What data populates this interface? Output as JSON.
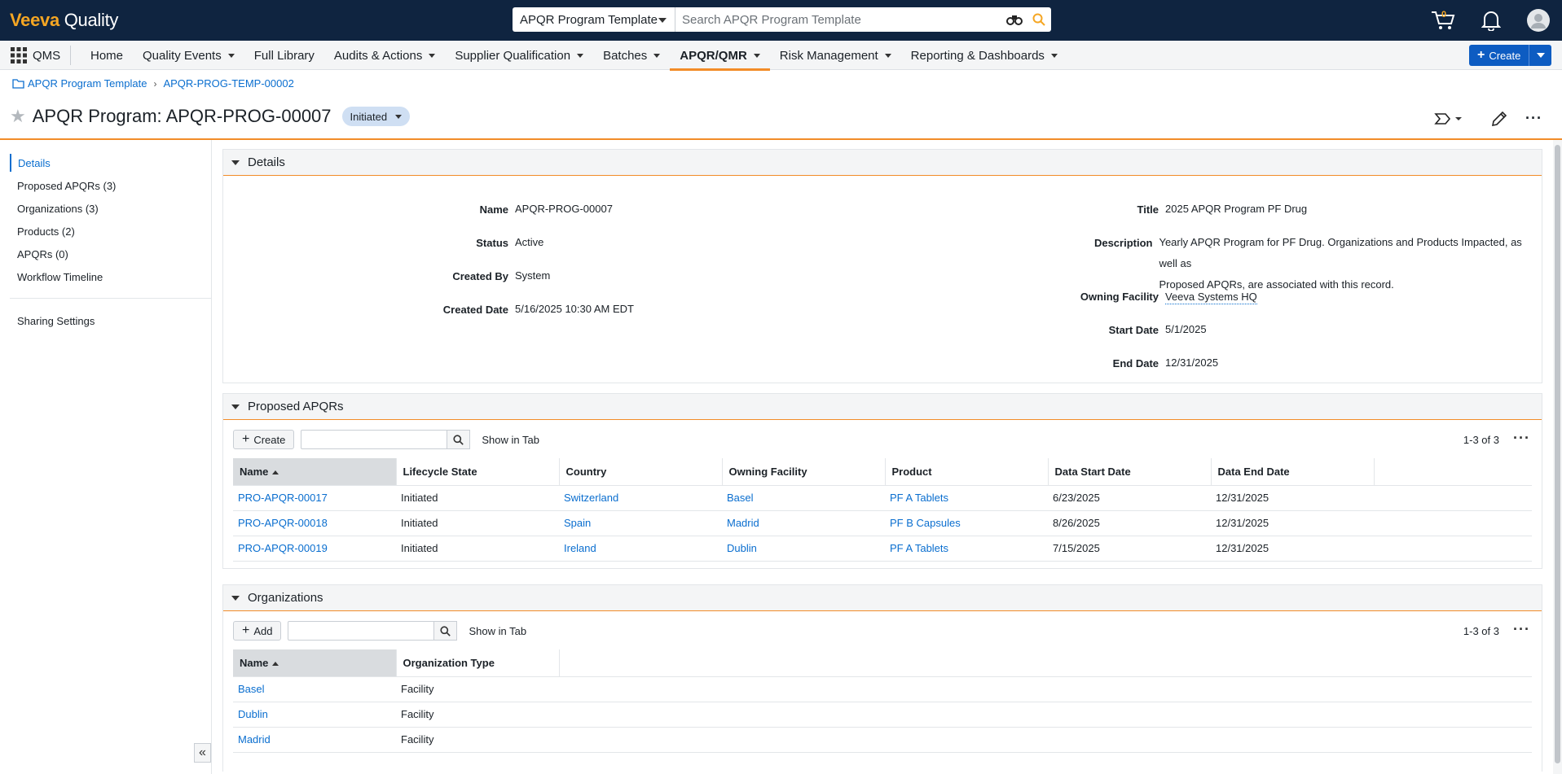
{
  "app": {
    "logo_brand": "Veeva",
    "logo_product": "Quality"
  },
  "search": {
    "scope": "APQR Program Template",
    "placeholder": "Search APQR Program Template"
  },
  "header": {
    "cart_count": "0"
  },
  "nav": {
    "app_name": "QMS",
    "items": [
      {
        "label": "Home",
        "dropdown": false
      },
      {
        "label": "Quality Events",
        "dropdown": true
      },
      {
        "label": "Full Library",
        "dropdown": false
      },
      {
        "label": "Audits & Actions",
        "dropdown": true
      },
      {
        "label": "Supplier Qualification",
        "dropdown": true
      },
      {
        "label": "Batches",
        "dropdown": true
      },
      {
        "label": "APQR/QMR",
        "dropdown": true,
        "active": true
      },
      {
        "label": "Risk Management",
        "dropdown": true
      },
      {
        "label": "Reporting & Dashboards",
        "dropdown": true
      }
    ],
    "create_label": "Create"
  },
  "breadcrumb": {
    "parent": "APQR Program Template",
    "current": "APQR-PROG-TEMP-00002"
  },
  "record": {
    "title": "APQR Program: APQR-PROG-00007",
    "status": "Initiated"
  },
  "sidebar": {
    "items": [
      "Details",
      "Proposed APQRs (3)",
      "Organizations (3)",
      "Products (2)",
      "APQRs (0)",
      "Workflow Timeline"
    ],
    "sharing": "Sharing Settings",
    "collapse": "«"
  },
  "details": {
    "section_title": "Details",
    "left": [
      {
        "label": "Name",
        "value": "APQR-PROG-00007"
      },
      {
        "label": "Status",
        "value": "Active"
      },
      {
        "label": "Created By",
        "value": "System"
      },
      {
        "label": "Created Date",
        "value": "5/16/2025 10:30 AM EDT"
      }
    ],
    "right": {
      "title_label": "Title",
      "title_value": "2025 APQR Program PF Drug",
      "desc_label": "Description",
      "desc_line1": "Yearly APQR Program for PF Drug. Organizations and Products Impacted, as well as",
      "desc_line2": "Proposed APQRs, are associated with this record.",
      "facility_label": "Owning Facility",
      "facility_value": "Veeva Systems HQ",
      "start_label": "Start Date",
      "start_value": "5/1/2025",
      "end_label": "End Date",
      "end_value": "12/31/2025"
    }
  },
  "proposed": {
    "section_title": "Proposed APQRs",
    "create_label": "Create",
    "show_in_tab": "Show in Tab",
    "count": "1-3 of 3",
    "columns": [
      "Name",
      "Lifecycle State",
      "Country",
      "Owning Facility",
      "Product",
      "Data Start Date",
      "Data End Date"
    ],
    "rows": [
      [
        "PRO-APQR-00017",
        "Initiated",
        "Switzerland",
        "Basel",
        "PF A Tablets",
        "6/23/2025",
        "12/31/2025"
      ],
      [
        "PRO-APQR-00018",
        "Initiated",
        "Spain",
        "Madrid",
        "PF B Capsules",
        "8/26/2025",
        "12/31/2025"
      ],
      [
        "PRO-APQR-00019",
        "Initiated",
        "Ireland",
        "Dublin",
        "PF A Tablets",
        "7/15/2025",
        "12/31/2025"
      ]
    ]
  },
  "organizations": {
    "section_title": "Organizations",
    "add_label": "Add",
    "show_in_tab": "Show in Tab",
    "count": "1-3 of 3",
    "columns": [
      "Name",
      "Organization Type"
    ],
    "rows": [
      [
        "Basel",
        "Facility"
      ],
      [
        "Dublin",
        "Facility"
      ],
      [
        "Madrid",
        "Facility"
      ]
    ]
  },
  "colors": {
    "topbar": "#0f2440",
    "accent": "#f28c28",
    "link": "#0a6ecf",
    "primary_button": "#0d5cc2"
  }
}
